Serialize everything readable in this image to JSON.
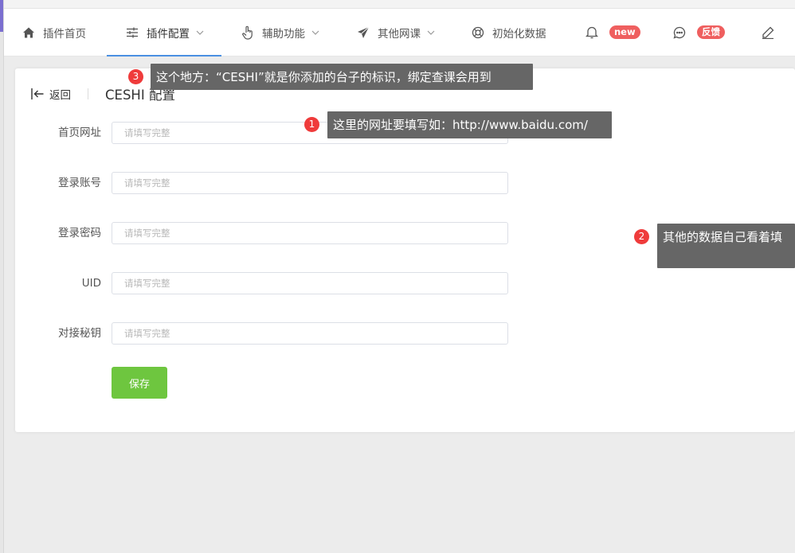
{
  "nav": {
    "items": [
      {
        "label": "插件首页",
        "icon": "home-icon"
      },
      {
        "label": "插件配置",
        "icon": "sliders-icon",
        "active": true
      },
      {
        "label": "辅助功能",
        "icon": "hand-pointer-icon"
      },
      {
        "label": "其他网课",
        "icon": "paper-plane-icon"
      },
      {
        "label": "初始化数据",
        "icon": "lifebuoy-icon"
      },
      {
        "label": "",
        "icon": "bell-icon",
        "badge": "new"
      },
      {
        "label": "",
        "icon": "chat-icon",
        "badge": "反馈"
      },
      {
        "label": "",
        "icon": "pen-icon"
      }
    ]
  },
  "header": {
    "back_label": "返回",
    "title": "CESHI 配置"
  },
  "form": {
    "fields": [
      {
        "label": "首页网址",
        "placeholder": "请填写完整",
        "value": ""
      },
      {
        "label": "登录账号",
        "placeholder": "请填写完整",
        "value": ""
      },
      {
        "label": "登录密码",
        "placeholder": "请填写完整",
        "value": ""
      },
      {
        "label": "UID",
        "placeholder": "请填写完整",
        "value": ""
      },
      {
        "label": "对接秘钥",
        "placeholder": "请填写完整",
        "value": ""
      }
    ],
    "save_label": "保存"
  },
  "annotations": [
    {
      "number": "3",
      "text": "这个地方：“CESHI”就是你添加的台子的标识，绑定查课会用到"
    },
    {
      "number": "1",
      "text": "这里的网址要填写如：http://www.baidu.com/"
    },
    {
      "number": "2",
      "text": "其他的数据自己看着填"
    }
  ],
  "colors": {
    "accent": "#4a90e2",
    "save_button": "#6ec63f",
    "badge": "#ef5f5f",
    "tooltip_bg": "#666666",
    "annotation_number": "#ef3b3b"
  }
}
